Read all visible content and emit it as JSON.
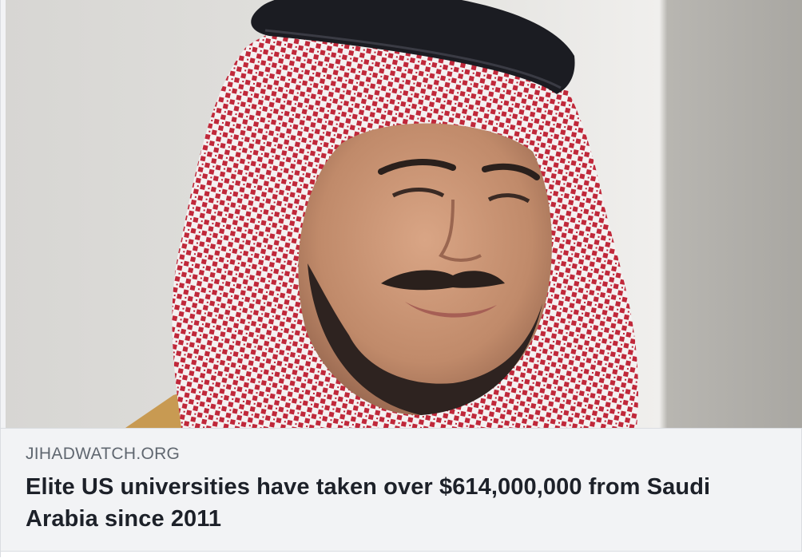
{
  "link_preview": {
    "image": {
      "alt": "",
      "subject": "portrait of a smiling bearded man wearing a red-and-white checked headscarf with a black band"
    },
    "domain": "JIHADWATCH.ORG",
    "headline": "Elite US universities have taken over $614,000,000 from Saudi Arabia since 2011"
  },
  "colors": {
    "card_background": "#f2f3f5",
    "border": "#dadde1",
    "domain_text": "#606770",
    "headline_text": "#1d2129",
    "photo_backdrop": "#dedddb",
    "headscarf_red": "#c0283a",
    "headscarf_white": "#f4f1f1",
    "agal_black": "#1b1c22"
  }
}
